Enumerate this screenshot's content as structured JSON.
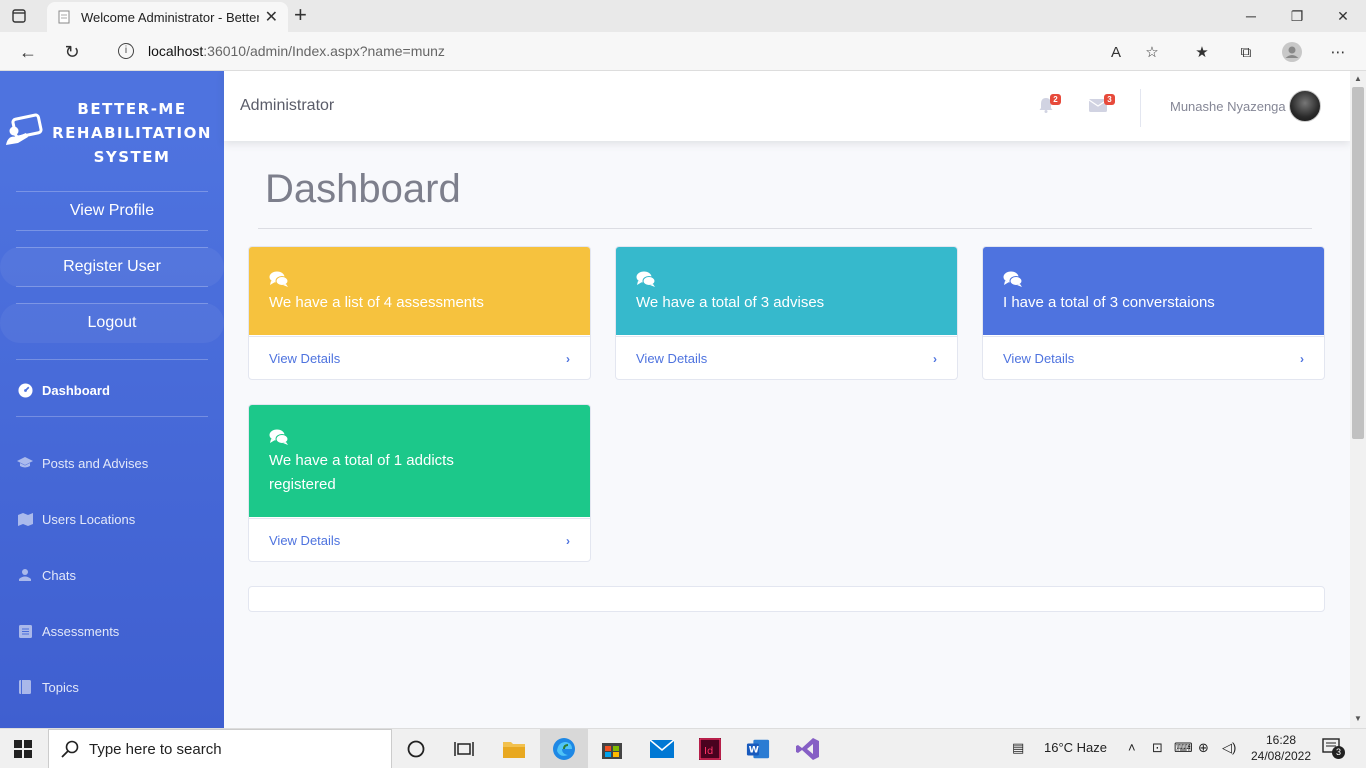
{
  "browser": {
    "tab_title": "Welcome Administrator - Better-",
    "url_host": "localhost",
    "url_rest": ":36010/admin/Index.aspx?name=munz"
  },
  "sidebar": {
    "brand": [
      "BETTER-ME",
      "REHABILITATION",
      "SYSTEM"
    ],
    "buttons": [
      {
        "label": "View Profile"
      },
      {
        "label": "Register User"
      },
      {
        "label": "Logout"
      }
    ],
    "active_item": {
      "label": "Dashboard"
    },
    "items": [
      {
        "label": "Posts and Advises",
        "icon": "graduation-cap-icon"
      },
      {
        "label": "Users Locations",
        "icon": "map-icon"
      },
      {
        "label": "Chats",
        "icon": "chat-icon"
      },
      {
        "label": "Assessments",
        "icon": "list-icon"
      },
      {
        "label": "Topics",
        "icon": "book-icon"
      }
    ]
  },
  "topbar": {
    "title": "Administrator",
    "alerts_count": "2",
    "messages_count": "3",
    "user_name": "Munashe Nyazenga"
  },
  "main": {
    "heading": "Dashboard",
    "cards": [
      {
        "message": "We have a list of 4 assessments",
        "link": "View Details",
        "color": "#f6c23e"
      },
      {
        "message": "We have a total of 3 advises",
        "link": "View Details",
        "color": "#36b9cc"
      },
      {
        "message": "I have a total of 3 converstaions",
        "link": "View Details",
        "color": "#4e73df"
      },
      {
        "message": "We have a total of 1 addicts registered",
        "link": "View Details",
        "color": "#1cc88a"
      }
    ]
  },
  "taskbar": {
    "search_placeholder": "Type here to search",
    "weather": "16°C  Haze",
    "time": "16:28",
    "date": "24/08/2022",
    "notifications": "3"
  }
}
